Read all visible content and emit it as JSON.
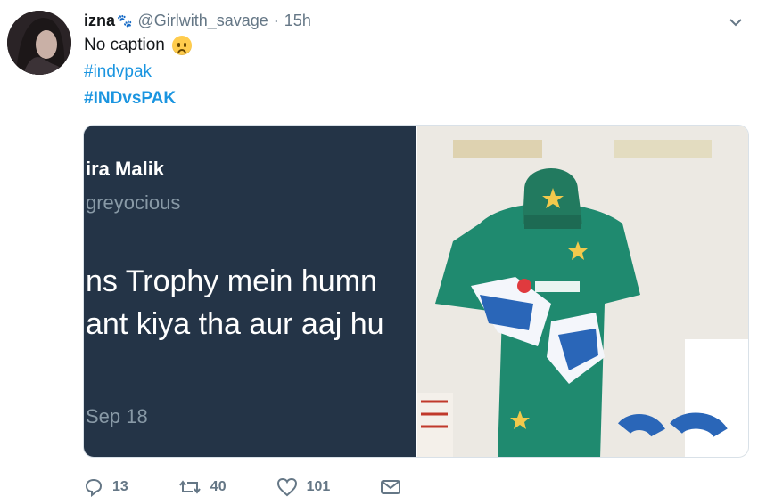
{
  "tweet": {
    "name": "izna",
    "handle": "@Girlwith_savage",
    "separator": "·",
    "time": "15h",
    "caption": "No caption",
    "hashtags": [
      "#indvpak",
      "#INDvsPAK"
    ]
  },
  "media": {
    "left": {
      "name": "ira Malik",
      "handle": "greyocious",
      "line1": "ns Trophy mein humn",
      "line2": "ant kiya tha aur aaj hu",
      "date": "Sep 18"
    },
    "right": {
      "description_icon": "cricket-keeper-photo"
    }
  },
  "actions": {
    "replies": "13",
    "retweets": "40",
    "likes": "101"
  },
  "colors": {
    "link": "#1b95e0",
    "muted": "#657786",
    "dark_panel": "#243447",
    "jersey": "#1f8a6f"
  }
}
